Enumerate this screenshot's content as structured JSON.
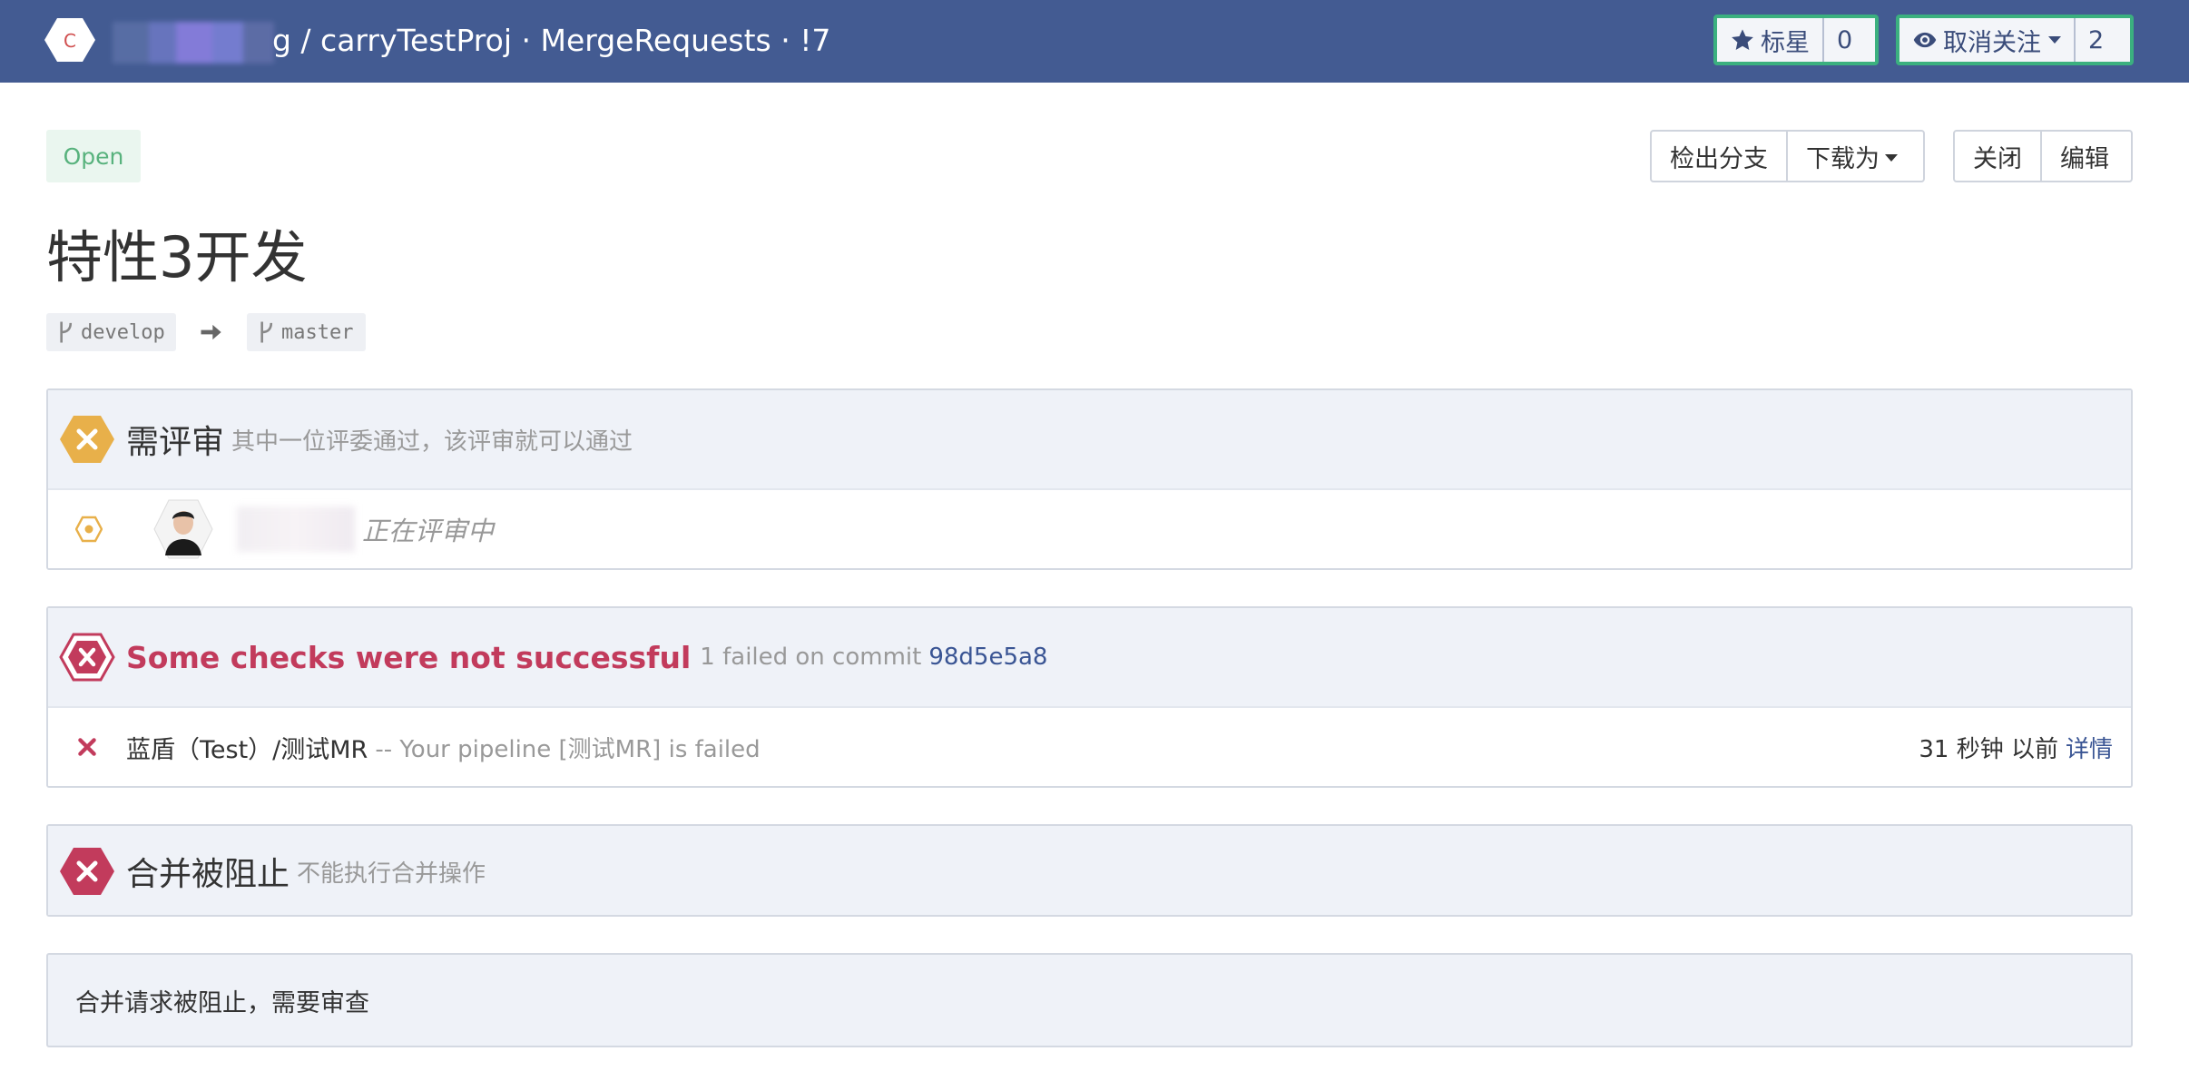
{
  "topbar": {
    "logo_letter": "C",
    "path_suffix": "g / carryTestProj · MergeRequests · !7",
    "star": {
      "label": "标星",
      "count": "0"
    },
    "watch": {
      "label": "取消关注",
      "count": "2"
    }
  },
  "merge_request": {
    "status": "Open",
    "title": "特性3开发",
    "source_branch": "develop",
    "target_branch": "master",
    "actions": {
      "checkout": "检出分支",
      "download": "下载为",
      "close": "关闭",
      "edit": "编辑"
    }
  },
  "review": {
    "title": "需评审",
    "subtitle": "其中一位评委通过，该评审就可以通过",
    "reviewer_status": "正在评审中"
  },
  "checks": {
    "title": "Some checks were not successful",
    "summary_prefix": "1 failed on commit",
    "commit": "98d5e5a8",
    "items": [
      {
        "name": "蓝盾（Test）/测试MR",
        "message": "-- Your pipeline [测试MR] is failed",
        "time": "31 秒钟 以前",
        "details_label": "详情"
      }
    ]
  },
  "merge_block": {
    "title": "合并被阻止",
    "subtitle": "不能执行合并操作",
    "message": "合并请求被阻止，需要审查"
  },
  "colors": {
    "topbar": "#435b92",
    "accent_green": "#3bb07f",
    "warning": "#e8b04a",
    "danger": "#c23b5c",
    "link": "#3a5594"
  },
  "icons": [
    "project-logo-icon",
    "star-icon",
    "eye-icon",
    "branch-icon",
    "arrow-right-icon",
    "warning-hex-icon",
    "pending-icon",
    "fail-hex-icon",
    "cross-icon"
  ]
}
